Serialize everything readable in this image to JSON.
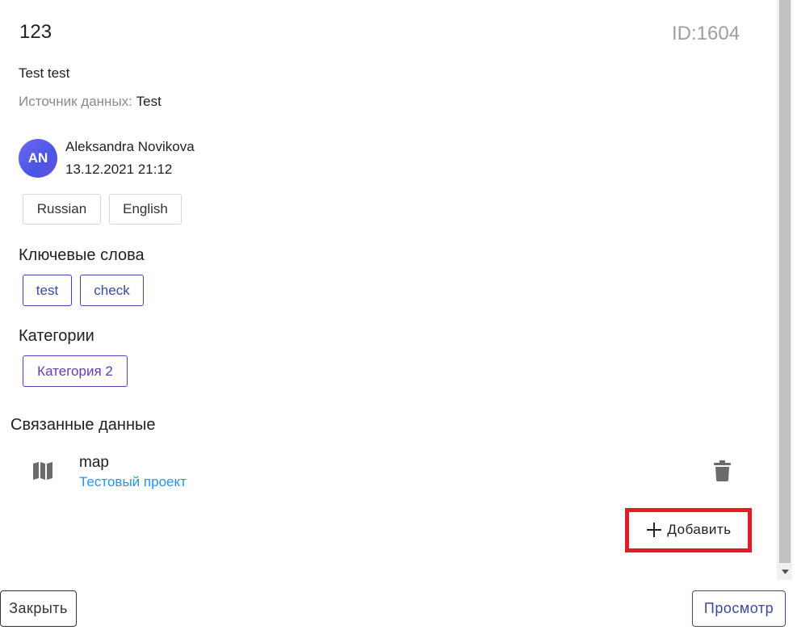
{
  "record": {
    "title": "123",
    "id_label": "ID:1604",
    "description": "Test test",
    "source_label": "Источник данных:",
    "source_value": "Test"
  },
  "author": {
    "initials": "AN",
    "name": "Aleksandra Novikova",
    "date": "13.12.2021 21:12"
  },
  "languages": [
    "Russian",
    "English"
  ],
  "keywords": {
    "heading": "Ключевые слова",
    "items": [
      "test",
      "check"
    ]
  },
  "categories": {
    "heading": "Категории",
    "items": [
      "Категория 2"
    ]
  },
  "linked": {
    "heading": "Связанные данные",
    "items": [
      {
        "name": "map",
        "project": "Тестовый проект",
        "icon": "map-icon"
      }
    ],
    "add_label": "Добавить"
  },
  "footer": {
    "close_label": "Закрыть",
    "view_label": "Просмотр"
  },
  "colors": {
    "keyword_chip": "#3949ab",
    "category_chip": "#673ab7",
    "link": "#2196f3",
    "highlight": "#e01c24"
  }
}
